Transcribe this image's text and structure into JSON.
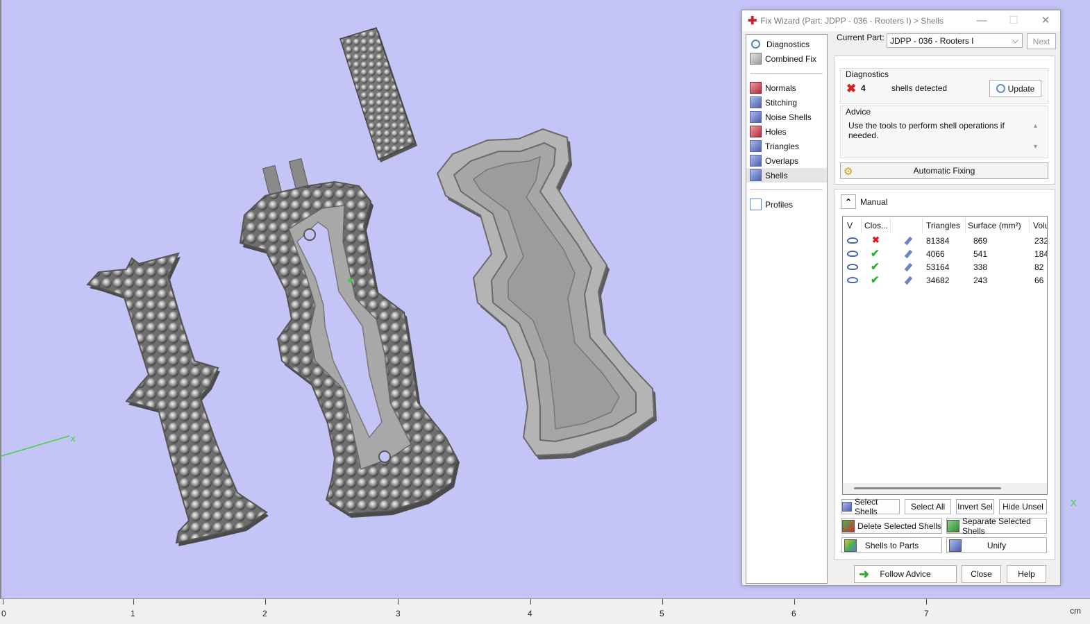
{
  "window": {
    "title": "Fix Wizard (Part: JDPP - 036 - Rooters I) > Shells",
    "minimize": "—",
    "maximize": "☐",
    "close": "✕"
  },
  "nav": {
    "top": [
      {
        "label": "Diagnostics",
        "icon": "magnifier-icon"
      },
      {
        "label": "Combined Fix",
        "icon": "combined-fix-icon"
      }
    ],
    "tools": [
      {
        "label": "Normals",
        "icon": "normals-icon"
      },
      {
        "label": "Stitching",
        "icon": "stitching-icon"
      },
      {
        "label": "Noise Shells",
        "icon": "noise-shells-icon"
      },
      {
        "label": "Holes",
        "icon": "holes-icon"
      },
      {
        "label": "Triangles",
        "icon": "triangles-icon"
      },
      {
        "label": "Overlaps",
        "icon": "overlaps-icon"
      },
      {
        "label": "Shells",
        "icon": "shells-icon",
        "selected": true
      }
    ],
    "bottom": [
      {
        "label": "Profiles",
        "icon": "profiles-icon"
      }
    ]
  },
  "current_part": {
    "label": "Current Part:",
    "value": "JDPP - 036 - Rooters I",
    "next_button": "Next"
  },
  "diagnostics": {
    "title": "Diagnostics",
    "count": "4",
    "text": "shells detected",
    "update_button": "Update"
  },
  "advice": {
    "title": "Advice",
    "text": "Use the tools to perform shell operations if needed."
  },
  "automatic_fixing": "Automatic Fixing",
  "manual": {
    "title": "Manual",
    "columns": [
      "V",
      "Clos...",
      "",
      "Triangles",
      "Surface (mm²)",
      "Volu"
    ],
    "rows": [
      {
        "closed": false,
        "triangles": "81384",
        "surface": "869",
        "volume": "232"
      },
      {
        "closed": true,
        "triangles": "4066",
        "surface": "541",
        "volume": "184"
      },
      {
        "closed": true,
        "triangles": "53164",
        "surface": "338",
        "volume": "82"
      },
      {
        "closed": true,
        "triangles": "34682",
        "surface": "243",
        "volume": "66"
      }
    ],
    "buttons": {
      "select_shells": "Select Shells",
      "select_all": "Select All",
      "invert_sel": "Invert Sel",
      "hide_unsel": "Hide Unsel",
      "delete_selected": "Delete Selected Shells",
      "separate_selected": "Separate Selected Shells",
      "shells_to_parts": "Shells to Parts",
      "unify": "Unify"
    }
  },
  "footer": {
    "follow_advice": "Follow Advice",
    "close": "Close",
    "help": "Help"
  },
  "ruler": {
    "labels": [
      "0",
      "1",
      "2",
      "3",
      "4",
      "5",
      "6",
      "7"
    ],
    "unit": "cm"
  },
  "axis_labels": {
    "x_left": "x",
    "x_right": "X"
  },
  "colors": {
    "viewport_bg": "#c4c5f6",
    "model_gray": "#9a9a9a",
    "check_green": "#2bb024",
    "error_red": "#d42020"
  }
}
